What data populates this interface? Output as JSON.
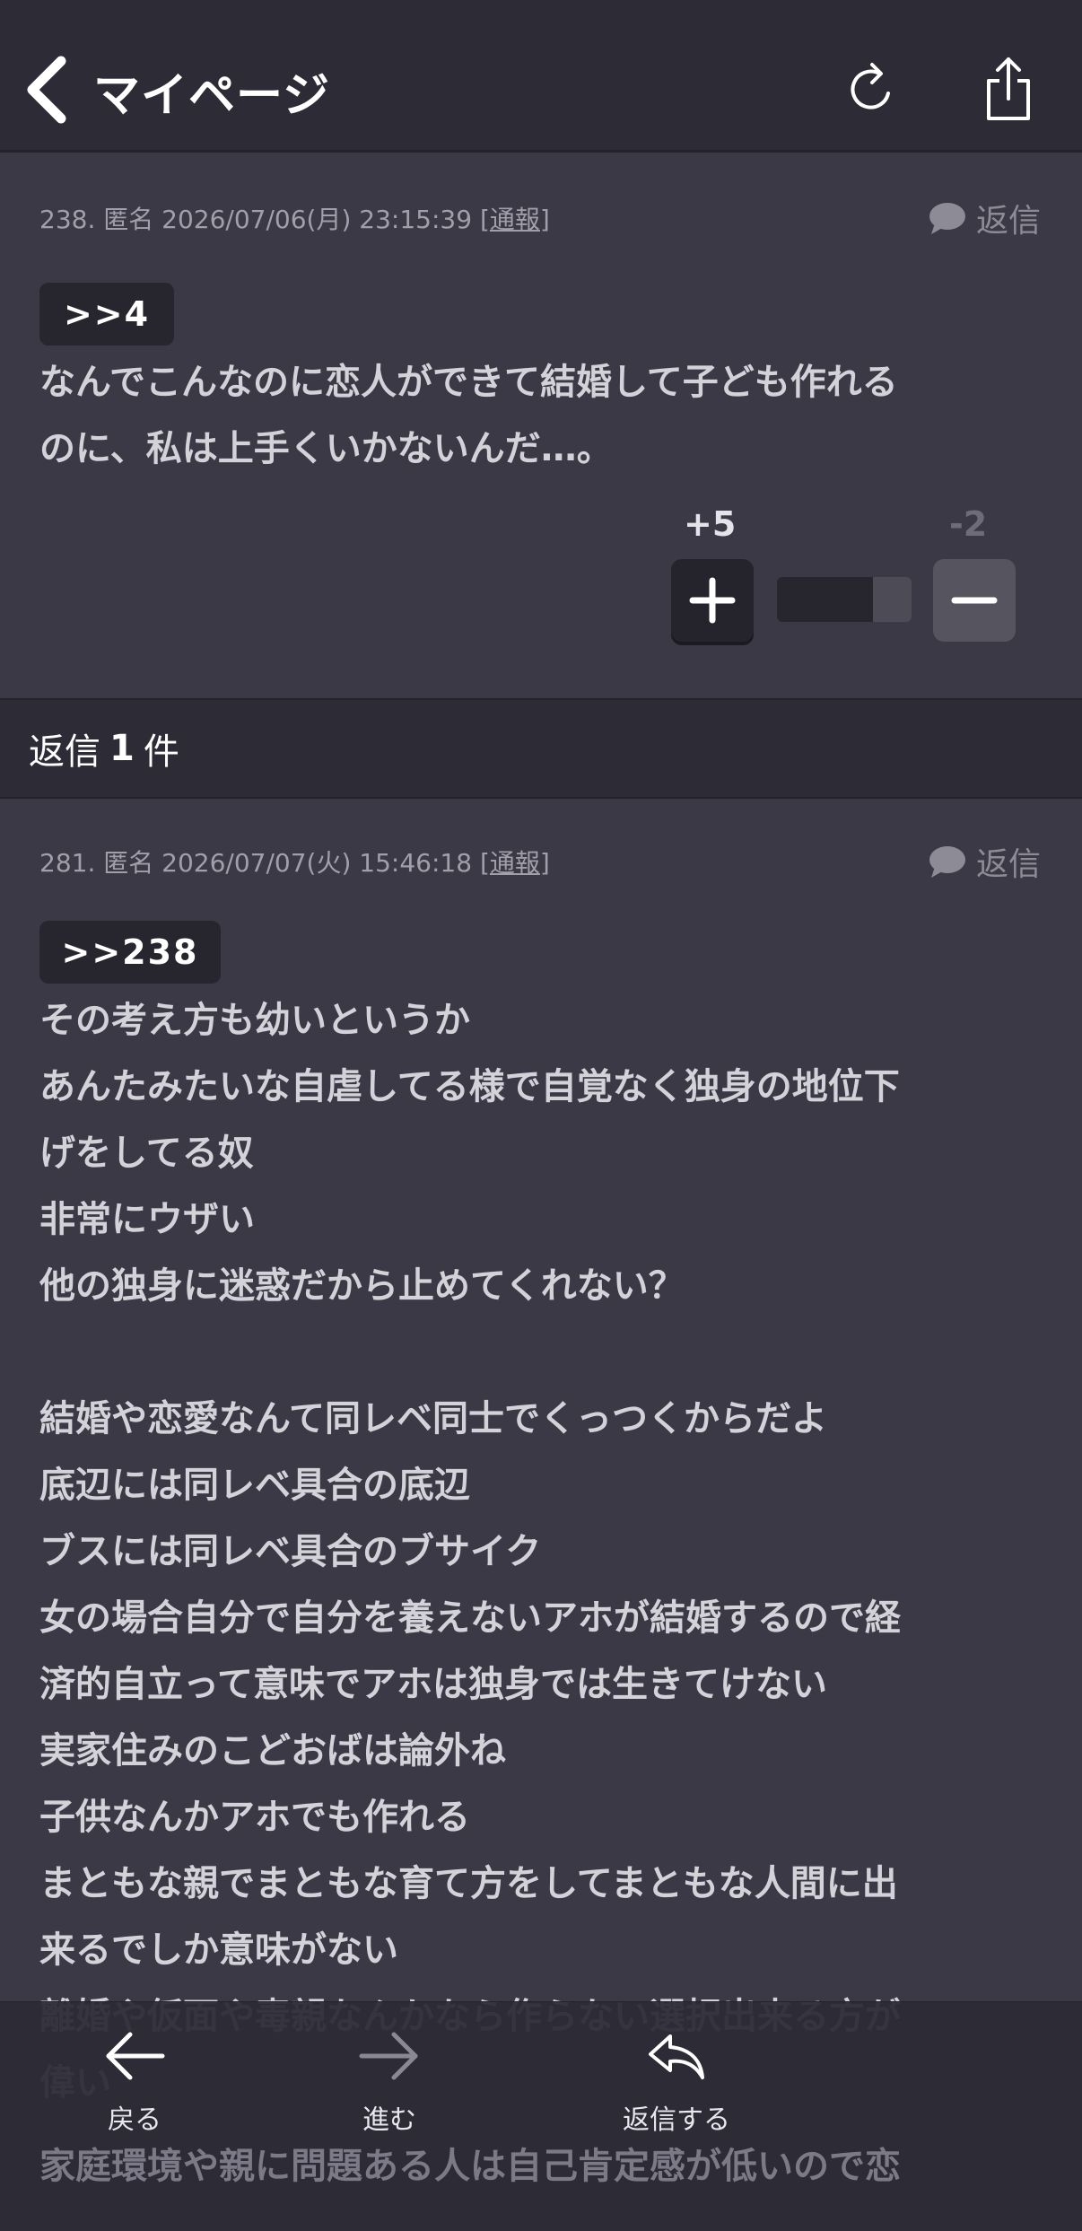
{
  "header": {
    "title": "マイページ",
    "back_icon": "chevron-left-icon",
    "reload_icon": "reload-icon",
    "share_icon": "share-icon"
  },
  "post1": {
    "number": "238.",
    "author": "匿名",
    "datetime": "2026/07/06(月) 23:15:39",
    "report": "通報",
    "reply_label": "返信",
    "anchor": ">>4",
    "body": "なんでこんなのに恋人ができて結婚して子ども作れる\nのに、私は上手くいかないんだ…。",
    "votes": {
      "plus": "+5",
      "minus": "-2",
      "ratio": 0.71
    }
  },
  "reply_count": {
    "prefix": "返信",
    "count": "1",
    "suffix": "件"
  },
  "post2": {
    "number": "281.",
    "author": "匿名",
    "datetime": "2026/07/07(火) 15:46:18",
    "report": "通報",
    "reply_label": "返信",
    "anchor": ">>238",
    "body": "その考え方も幼いというか\nあんたみたいな自虐してる様で自覚なく独身の地位下\nげをしてる奴\n非常にウザい\n他の独身に迷惑だから止めてくれない？\n\n結婚や恋愛なんて同レベ同士でくっつくからだよ\n底辺には同レベ具合の底辺\nブスには同レベ具合のブサイク\n女の場合自分で自分を養えないアホが結婚するので経\n済的自立って意味でアホは独身では生きてけない\n実家住みのこどおばは論外ね\n子供なんかアホでも作れる\nまともな親でまともな育て方をしてまともな人間に出\n来るでしか意味がない\n離婚や仮面や毒親なんかなら作らない選択出来る方が\n偉い"
  },
  "bottom_nav": {
    "back": "戻る",
    "forward": "進む",
    "reply": "返信する"
  },
  "ghost_text": "家庭環境や親に問題ある人は自己肯定感が低いので恋"
}
